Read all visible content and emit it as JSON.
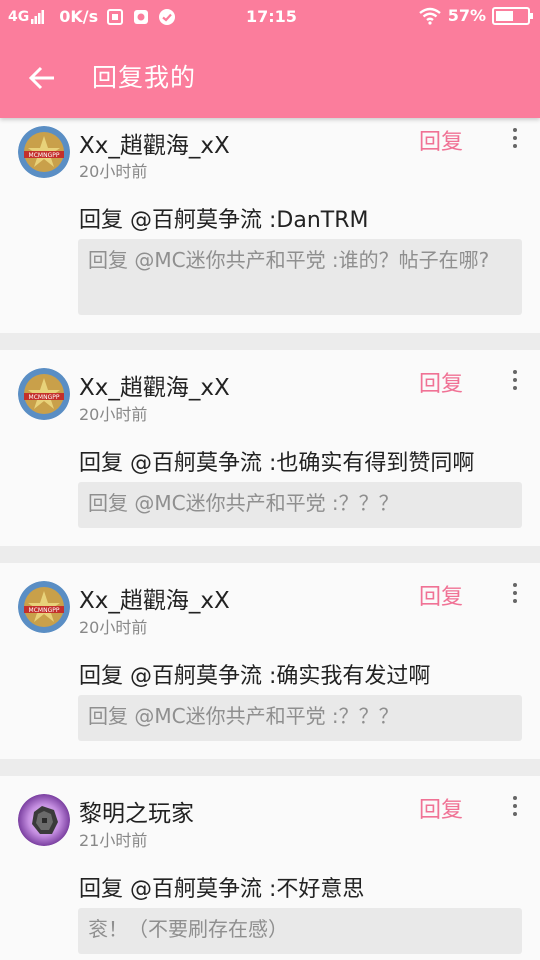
{
  "status_bar": {
    "network": "4G",
    "speed": "0K/s",
    "time": "17:15",
    "battery_pct": "57%",
    "battery_level": 0.57
  },
  "toolbar": {
    "title": "回复我的",
    "back_icon": "arrow-left-icon"
  },
  "colors": {
    "accent": "#fb7d9c",
    "reply": "#f07295",
    "card_bg": "#fafafa",
    "quote_bg": "#e9e9e9",
    "page_bg": "#ececec"
  },
  "replies": [
    {
      "username": "Xx_趙觀海_xX",
      "time": "20小时前",
      "reply_label": "回复",
      "content": "回复 @百舸莫争流 :DanTRM",
      "quote": "回复 @MC迷你共产和平党 :谁的？帖子在哪?"
    },
    {
      "username": "Xx_趙觀海_xX",
      "time": "20小时前",
      "reply_label": "回复",
      "content": "回复 @百舸莫争流 :也确实有得到赞同啊",
      "quote": "回复 @MC迷你共产和平党 :？？？"
    },
    {
      "username": "Xx_趙觀海_xX",
      "time": "20小时前",
      "reply_label": "回复",
      "content": "回复 @百舸莫争流 :确实我有发过啊",
      "quote": "回复 @MC迷你共产和平党 :？？？"
    },
    {
      "username": "黎明之玩家",
      "time": "21小时前",
      "reply_label": "回复",
      "content": "回复 @百舸莫争流 :不好意思",
      "quote": "衮！（不要刷存在感）"
    }
  ]
}
